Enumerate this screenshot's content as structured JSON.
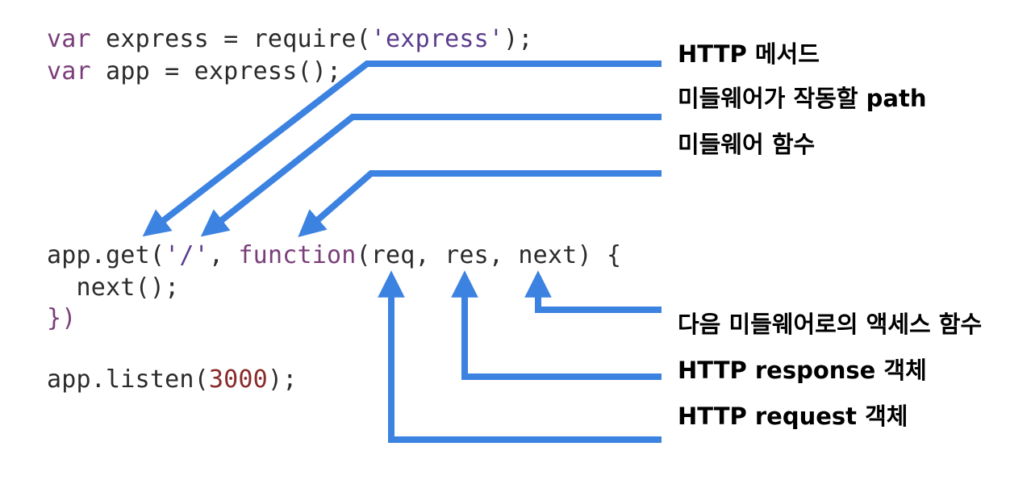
{
  "code": {
    "line1": {
      "kw": "var",
      "rest": " express = require(",
      "str": "'express'",
      "end": ");"
    },
    "line2": {
      "kw": "var",
      "rest": " app = express();"
    },
    "line3": {
      "start": "app.get(",
      "str": "'/'",
      "mid": ", ",
      "kw": "function",
      "args": "(req, res, next) {"
    },
    "line4": {
      "text": "  next();"
    },
    "line5": {
      "text": "})"
    },
    "line6": {
      "start": "app.listen(",
      "num": "3000",
      "end": ");"
    }
  },
  "annotations": {
    "http_method": "HTTP 메서드",
    "path": "미들웨어가 작동할 path",
    "middleware_fn": "미들웨어 함수",
    "next_fn": "다음 미들웨어로의 액세스 함수",
    "response": "HTTP response 객체",
    "request": "HTTP request 객체"
  },
  "colors": {
    "arrow": "#3c82e0",
    "keyword": "#7a3e7a",
    "string": "#5b3c8c",
    "number": "#8a2a2a",
    "text": "#2b2b2b"
  }
}
